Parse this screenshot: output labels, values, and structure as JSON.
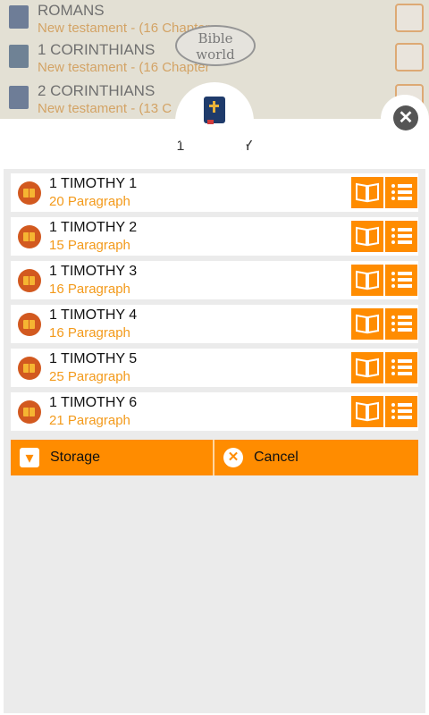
{
  "background": {
    "rows": [
      {
        "title": "ROMANS",
        "subtitle": "New testament - (16 Chapter"
      },
      {
        "title": "1 CORINTHIANS",
        "subtitle": "New testament - (16 Chapter"
      },
      {
        "title": "2 CORINTHIANS",
        "subtitle": "New testament - (13 C"
      }
    ],
    "logo_line1": "Bible",
    "logo_line2": "world"
  },
  "dialog": {
    "title": "1 TIMOTHY",
    "book_icon": "bible-book-icon",
    "close_icon": "close-icon"
  },
  "chapters": [
    {
      "title": "1 TIMOTHY 1",
      "subtitle": "20 Paragraph"
    },
    {
      "title": "1 TIMOTHY 2",
      "subtitle": "15 Paragraph"
    },
    {
      "title": "1 TIMOTHY 3",
      "subtitle": "16 Paragraph"
    },
    {
      "title": "1 TIMOTHY 4",
      "subtitle": "16 Paragraph"
    },
    {
      "title": "1 TIMOTHY 5",
      "subtitle": "25 Paragraph"
    },
    {
      "title": "1 TIMOTHY 6",
      "subtitle": "21 Paragraph"
    }
  ],
  "actions": {
    "storage_label": "Storage",
    "cancel_label": "Cancel"
  },
  "colors": {
    "accent": "#ff8c00",
    "subtitle": "#f39a1b"
  }
}
